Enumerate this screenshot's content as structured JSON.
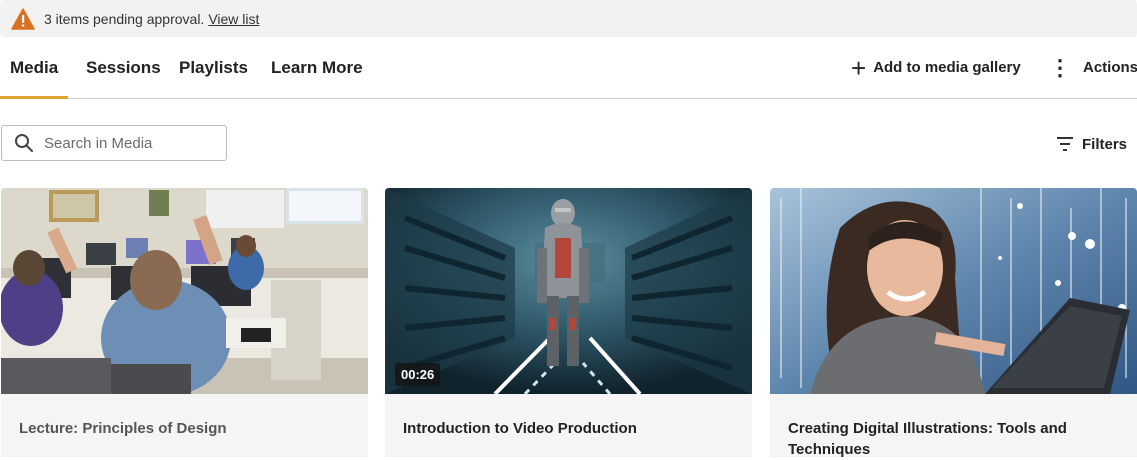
{
  "banner": {
    "message": "3 items pending approval.",
    "link": "View list",
    "icon": "warning-icon",
    "icon_color": "#d9701f"
  },
  "tabs": [
    {
      "label": "Media",
      "active": true
    },
    {
      "label": "Sessions",
      "active": false
    },
    {
      "label": "Playlists",
      "active": false
    },
    {
      "label": "Learn More",
      "active": false
    }
  ],
  "toolbar": {
    "add_label": "Add to media gallery",
    "actions_label": "Actions"
  },
  "search": {
    "placeholder": "Search in Media",
    "value": ""
  },
  "filters": {
    "label": "Filters"
  },
  "accent_color": "#e2a335",
  "media": [
    {
      "title": "Lecture: Principles of Design",
      "duration": ""
    },
    {
      "title": "Introduction to Video Production",
      "duration": "00:26"
    },
    {
      "title": "Creating Digital Illustrations: Tools and Techniques",
      "duration": ""
    }
  ]
}
